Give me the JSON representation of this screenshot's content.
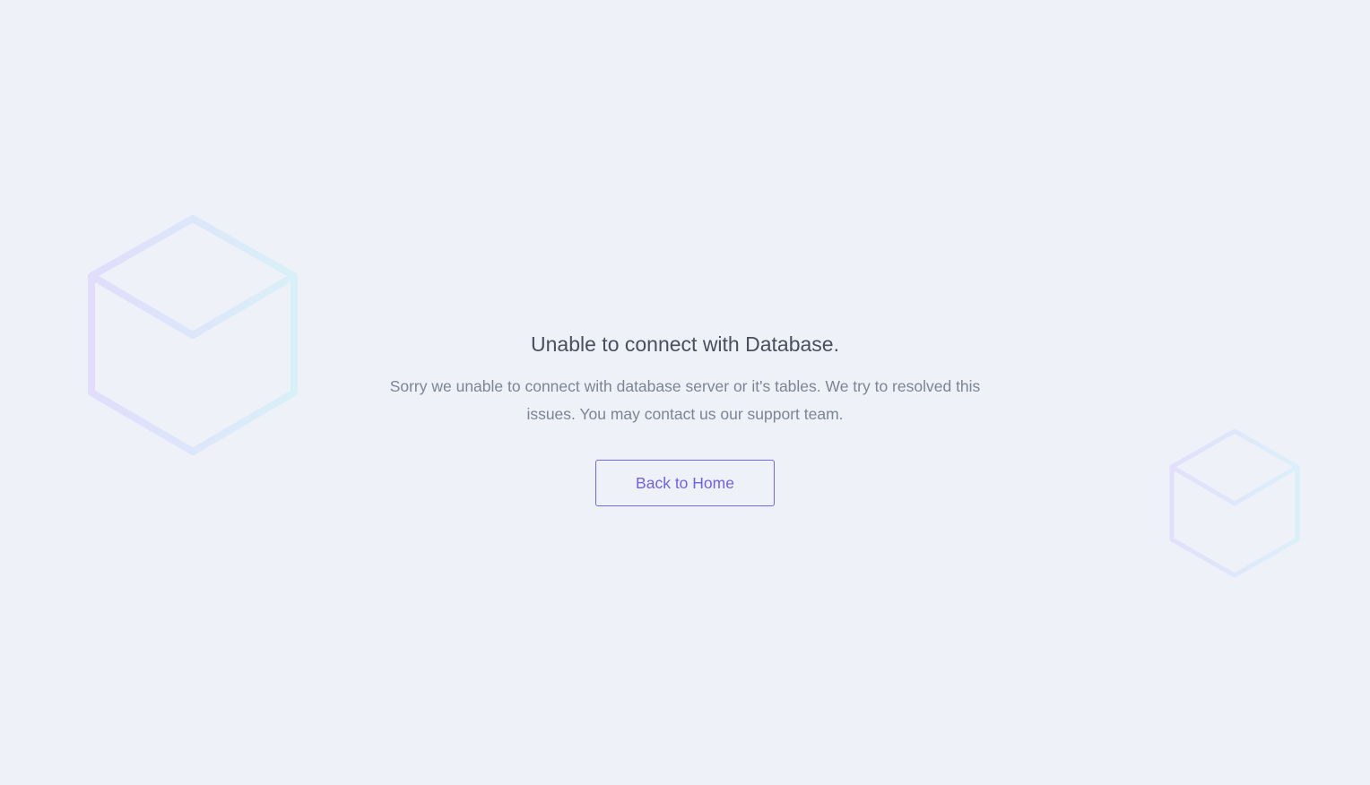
{
  "error": {
    "title": "Unable to connect with Database.",
    "message": "Sorry we unable to connect with database server or it's tables. We try to resolved this issues. You may contact us our support team.",
    "button_label": "Back to Home"
  },
  "decorations": {
    "left_icon": "cube-icon",
    "right_icon": "cube-icon"
  },
  "colors": {
    "background": "#eef1f8",
    "accent": "#7367f0",
    "title_text": "#494f5c",
    "body_text": "#7d8493",
    "cube_gradient_start": "#e1ddfb",
    "cube_gradient_end": "#d9f0f8"
  }
}
